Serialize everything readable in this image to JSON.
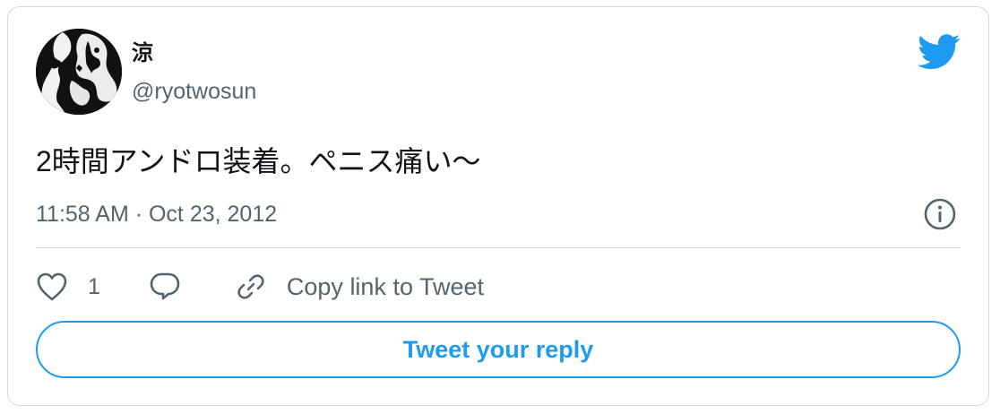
{
  "tweet": {
    "author": {
      "display_name": "涼",
      "handle": "@ryotwosun",
      "avatar_icon": "avatar-image"
    },
    "brand_icon": "twitter-bird-icon",
    "text": "2時間アンドロ装着。ペニス痛い〜",
    "timestamp": "11:58 AM · Oct 23, 2012",
    "info_icon": "info-icon",
    "actions": {
      "like_icon": "heart-icon",
      "like_count": "1",
      "reply_icon": "speech-bubble-icon",
      "copy_icon": "link-icon",
      "copy_label": "Copy link to Tweet"
    },
    "reply_button_label": "Tweet your reply"
  },
  "colors": {
    "accent": "#1d9bf0",
    "text_primary": "#0f1419",
    "text_secondary": "#536471",
    "border": "#cfd9de"
  }
}
